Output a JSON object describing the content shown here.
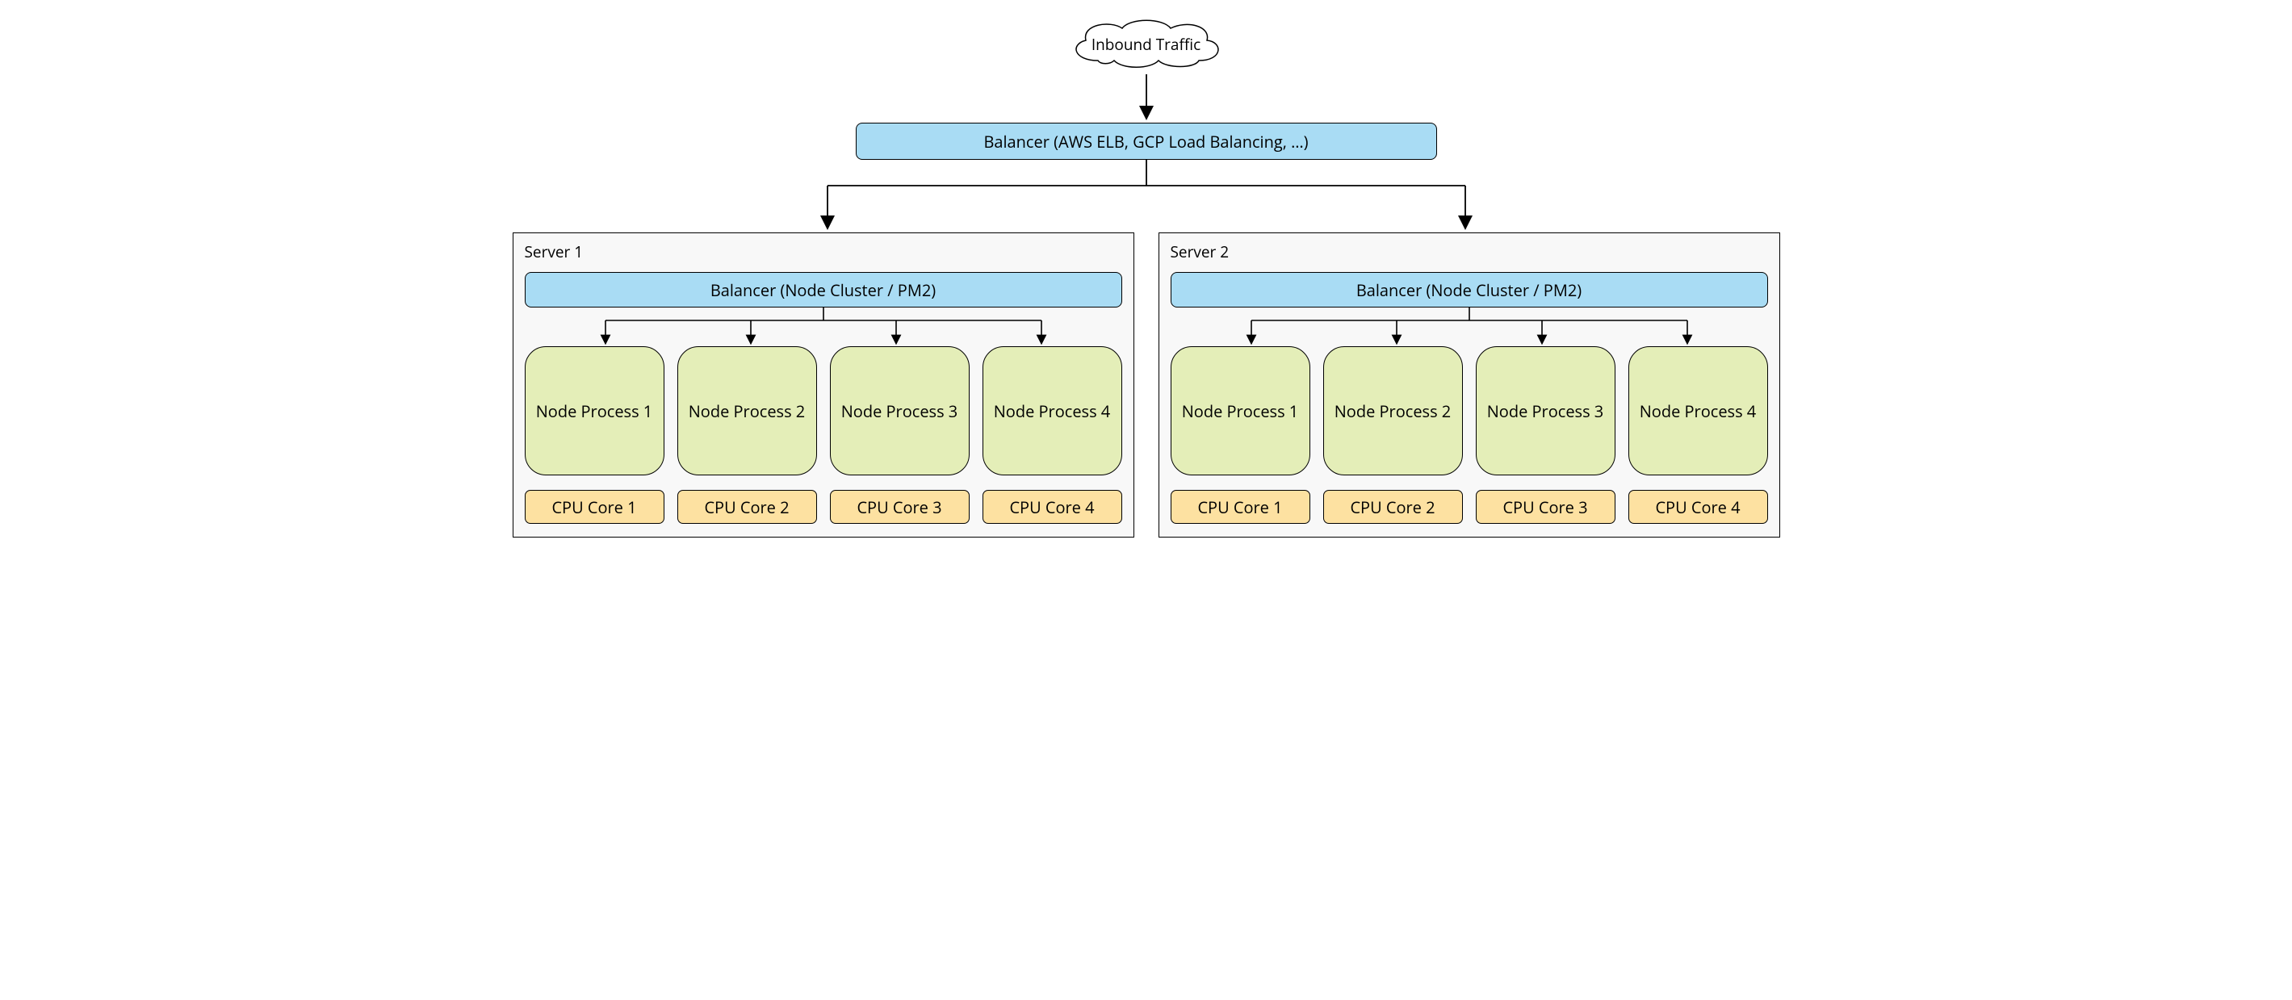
{
  "cloud_label": "Inbound Traffic",
  "top_balancer_label": "Balancer (AWS ELB, GCP Load Balancing, …)",
  "servers": [
    {
      "title": "Server 1",
      "balancer_label": "Balancer (Node Cluster / PM2)",
      "processes": [
        "Node Process 1",
        "Node Process 2",
        "Node Process 3",
        "Node Process 4"
      ],
      "cores": [
        "CPU Core 1",
        "CPU Core 2",
        "CPU Core 3",
        "CPU Core 4"
      ]
    },
    {
      "title": "Server 2",
      "balancer_label": "Balancer (Node Cluster / PM2)",
      "processes": [
        "Node Process 1",
        "Node Process 2",
        "Node Process 3",
        "Node Process 4"
      ],
      "cores": [
        "CPU Core 1",
        "CPU Core 2",
        "CPU Core 3",
        "CPU Core 4"
      ]
    }
  ]
}
